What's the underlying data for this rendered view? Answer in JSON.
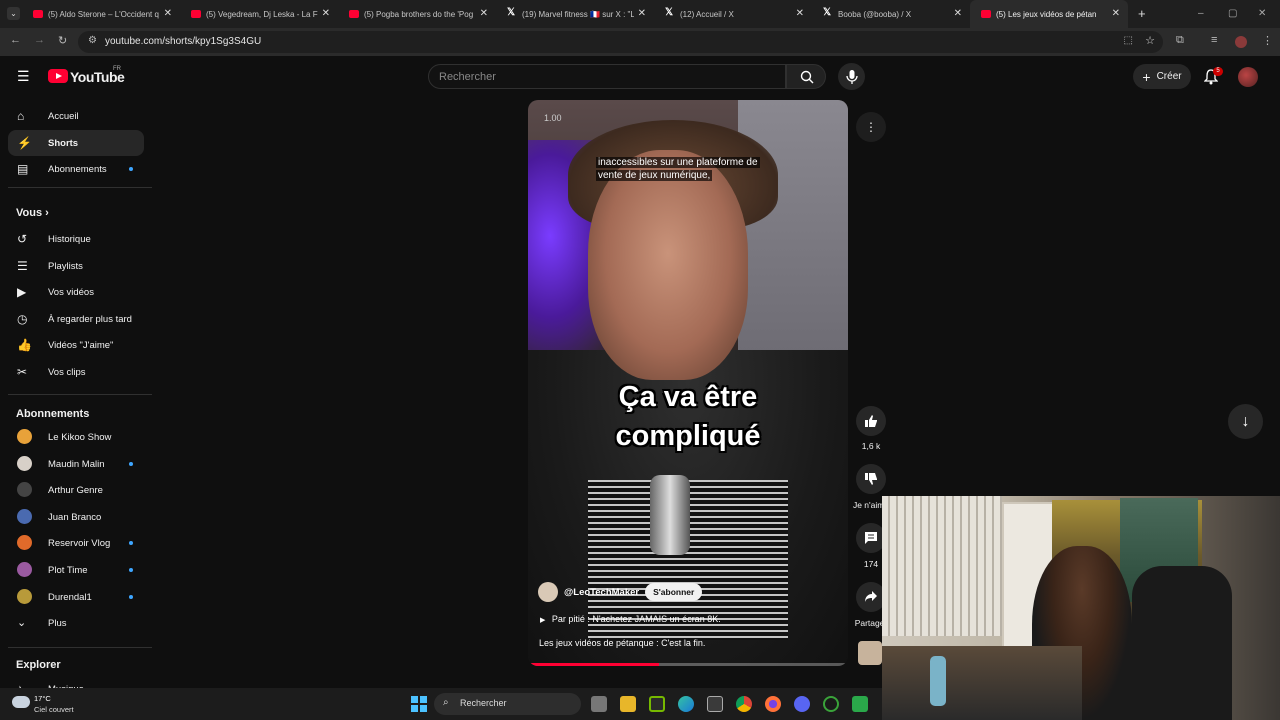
{
  "browser": {
    "tabs": [
      {
        "title": "(5) Aldo Sterone – L'Occident q",
        "type": "yt"
      },
      {
        "title": "(5) Vegedream, Dj Leska - La Fu",
        "type": "yt"
      },
      {
        "title": "(5) Pogba brothers do the 'Pog",
        "type": "yt"
      },
      {
        "title": "(19) Marvel fitness 🇫🇷 sur X : \"L",
        "type": "x"
      },
      {
        "title": "(12) Accueil / X",
        "type": "x"
      },
      {
        "title": "Booba (@booba) / X",
        "type": "x"
      },
      {
        "title": "(5) Les jeux vidéos de pétan",
        "type": "yt",
        "active": true
      }
    ],
    "url": "youtube.com/shorts/kpy1Sg3S4GU"
  },
  "header": {
    "logo": "YouTube",
    "country": "FR",
    "search_placeholder": "Rechercher",
    "create_label": "Créer",
    "notifications": "5"
  },
  "sidebar": {
    "main": [
      {
        "label": "Accueil",
        "icon": "home-icon"
      },
      {
        "label": "Shorts",
        "icon": "shorts-icon",
        "active": true
      },
      {
        "label": "Abonnements",
        "icon": "subscriptions-icon",
        "dot": true
      }
    ],
    "you_heading": "Vous",
    "you": [
      {
        "label": "Historique",
        "icon": "history-icon"
      },
      {
        "label": "Playlists",
        "icon": "playlists-icon"
      },
      {
        "label": "Vos vidéos",
        "icon": "your-videos-icon"
      },
      {
        "label": "À regarder plus tard",
        "icon": "watch-later-icon"
      },
      {
        "label": "Vidéos \"J'aime\"",
        "icon": "liked-icon"
      },
      {
        "label": "Vos clips",
        "icon": "clips-icon"
      }
    ],
    "subs_heading": "Abonnements",
    "subscriptions": [
      {
        "label": "Le Kikoo Show",
        "color": "#e8a23a"
      },
      {
        "label": "Maudin Malin",
        "color": "#d8d0c8",
        "dot": true
      },
      {
        "label": "Arthur Genre",
        "color": "#444444"
      },
      {
        "label": "Juan Branco",
        "color": "#4a6ab0"
      },
      {
        "label": "Reservoir Vlog",
        "color": "#e06a2a",
        "dot": true
      },
      {
        "label": "Plot Time",
        "color": "#9a5aa0",
        "dot": true
      },
      {
        "label": "Durendal1",
        "color": "#b89a3a",
        "dot": true
      }
    ],
    "more_label": "Plus",
    "explore_heading": "Explorer",
    "explore_first": "Musique"
  },
  "short": {
    "counter": "1.00",
    "caption_line1": "inaccessibles sur une plateforme de",
    "caption_line2": "vente de jeux numérique,",
    "overlay_line1": "Ça va être",
    "overlay_line2": "compliqué",
    "channel": "@LeoTechMaker",
    "subscribe": "S'abonner",
    "description": "Par pitié : N'achetez JAMAIS un écran 8K.",
    "title": "Les jeux vidéos de pétanque : C'est la fin.",
    "progress": 0.41
  },
  "actions": {
    "likes": "1,6 k",
    "dislike": "Je n'aime",
    "comments": "174",
    "share": "Partager"
  },
  "taskbar": {
    "temp": "17°C",
    "weather": "Ciel couvert",
    "search": "Rechercher"
  }
}
